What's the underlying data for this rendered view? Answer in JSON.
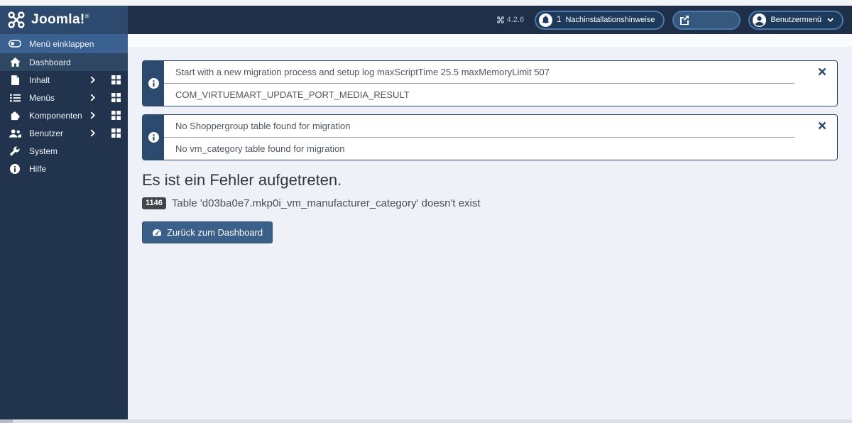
{
  "topbar": {
    "brand": "Joomla!",
    "brand_mark": "®",
    "version": "4.2.6",
    "notifications": {
      "count": "1",
      "label": "Nachinstallationshinweise"
    },
    "user_menu_label": "Benutzermenü"
  },
  "sidebar": {
    "items": [
      {
        "label": "Menü einklappen",
        "icon": "toggle-icon",
        "expandable": false
      },
      {
        "label": "Dashboard",
        "icon": "home-icon",
        "expandable": false
      },
      {
        "label": "Inhalt",
        "icon": "file-icon",
        "expandable": true
      },
      {
        "label": "Menüs",
        "icon": "list-icon",
        "expandable": true
      },
      {
        "label": "Komponenten",
        "icon": "puzzle-icon",
        "expandable": true
      },
      {
        "label": "Benutzer",
        "icon": "users-icon",
        "expandable": true
      },
      {
        "label": "System",
        "icon": "wrench-icon",
        "expandable": false
      },
      {
        "label": "Hilfe",
        "icon": "info-icon",
        "expandable": false
      }
    ]
  },
  "main": {
    "alerts": [
      {
        "lines": [
          "Start with a new migration process and setup log maxScriptTime 25.5 maxMemoryLimit 507",
          "COM_VIRTUEMART_UPDATE_PORT_MEDIA_RESULT"
        ]
      },
      {
        "lines": [
          "No Shoppergroup table found for migration",
          "No vm_category table found for migration"
        ]
      }
    ],
    "error_heading": "Es ist ein Fehler aufgetreten.",
    "error_code": "1146",
    "error_message": "Table 'd03ba0e7.mkp0i_vm_manufacturer_category' doesn't exist",
    "back_button_label": "Zurück zum Dashboard"
  },
  "colors": {
    "topbar_bg": "#1f2f47",
    "brand_bg": "#2d4a6e",
    "sidebar_bg": "#22344d",
    "sidebar_highlight": "#3a6191",
    "alert_accent": "#2c4a6e",
    "button_bg": "#3a5f88",
    "content_bg": "#eef1f7"
  }
}
